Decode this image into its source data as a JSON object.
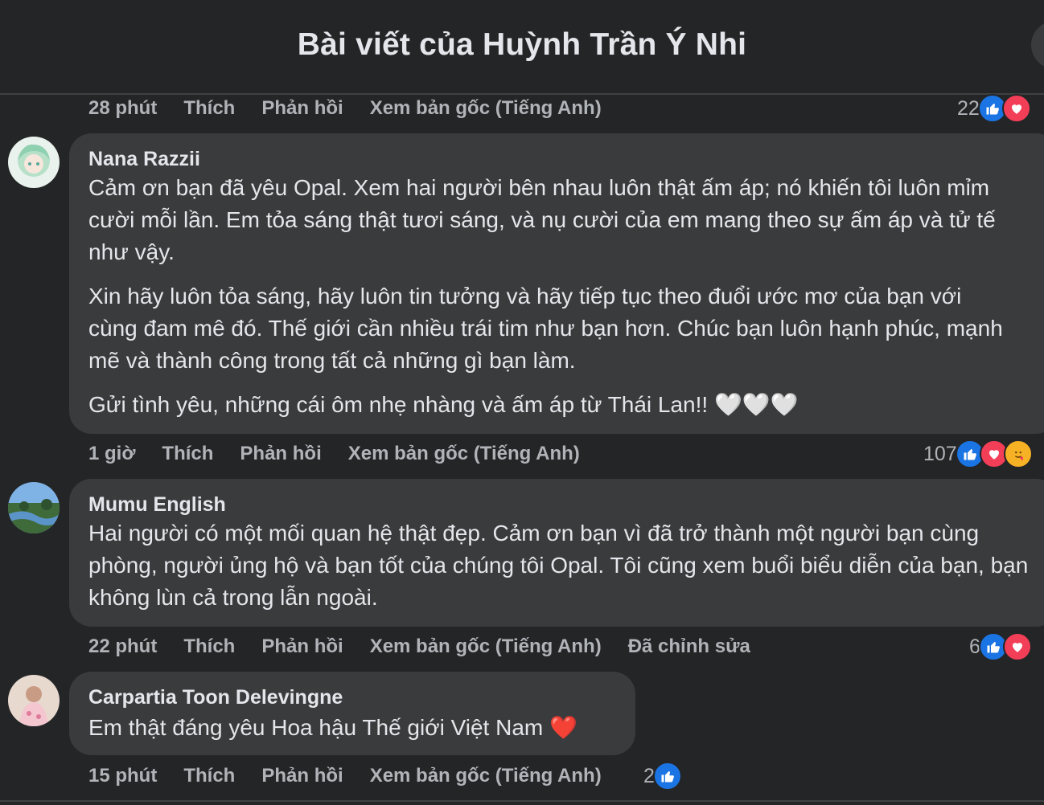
{
  "header": {
    "title": "Bài viết của Huỳnh Trần Ý Nhi"
  },
  "top_meta": {
    "time": "28 phút",
    "like": "Thích",
    "reply": "Phản hồi",
    "translate": "Xem bản gốc (Tiếng Anh)",
    "reaction_count": "22"
  },
  "comments": [
    {
      "author": "Nana Razzii",
      "paragraphs": [
        "Cảm ơn bạn đã yêu Opal. Xem hai người bên nhau luôn thật ấm áp; nó khiến tôi luôn mỉm cười mỗi lần. Em tỏa sáng thật tươi sáng, và nụ cười của em mang theo sự ấm áp và tử tế như vậy.",
        "Xin hãy luôn tỏa sáng, hãy luôn tin tưởng và hãy tiếp tục theo đuổi ước mơ của bạn với cùng đam mê đó. Thế giới cần nhiều trái tim như bạn hơn. Chúc bạn luôn hạnh phúc, mạnh mẽ và thành công trong tất cả những gì bạn làm.",
        "Gửi tình yêu, những cái ôm nhẹ nhàng và ấm áp từ Thái Lan!!"
      ],
      "emoji": "🤍🤍🤍",
      "meta": {
        "time": "1 giờ",
        "like": "Thích",
        "reply": "Phản hồi",
        "translate": "Xem bản gốc (Tiếng Anh)"
      },
      "reaction_count": "107"
    },
    {
      "author": "Mumu English",
      "paragraphs": [
        "Hai người có một mối quan hệ thật đẹp. Cảm ơn bạn vì đã trở thành một người bạn cùng phòng, người ủng hộ và bạn tốt của chúng tôi Opal. Tôi cũng xem buổi biểu diễn của bạn, bạn không lùn cả trong lẫn ngoài."
      ],
      "meta": {
        "time": "22 phút",
        "like": "Thích",
        "reply": "Phản hồi",
        "translate": "Xem bản gốc (Tiếng Anh)",
        "edited": "Đã chỉnh sửa"
      },
      "reaction_count": "6"
    },
    {
      "author": "Carpartia Toon Delevingne",
      "paragraphs": [
        "Em thật đáng yêu Hoa hậu Thế giới Việt Nam"
      ],
      "emoji": "❤️",
      "meta": {
        "time": "15 phút",
        "like": "Thích",
        "reply": "Phản hồi",
        "translate": "Xem bản gốc (Tiếng Anh)"
      },
      "reaction_count": "2"
    }
  ],
  "icons": {
    "like": "like-icon",
    "love": "love-icon",
    "care": "care-icon"
  },
  "colors": {
    "background": "#242526",
    "bubble": "#3a3b3c",
    "like": "#1b74e4",
    "love": "#f33e58"
  }
}
